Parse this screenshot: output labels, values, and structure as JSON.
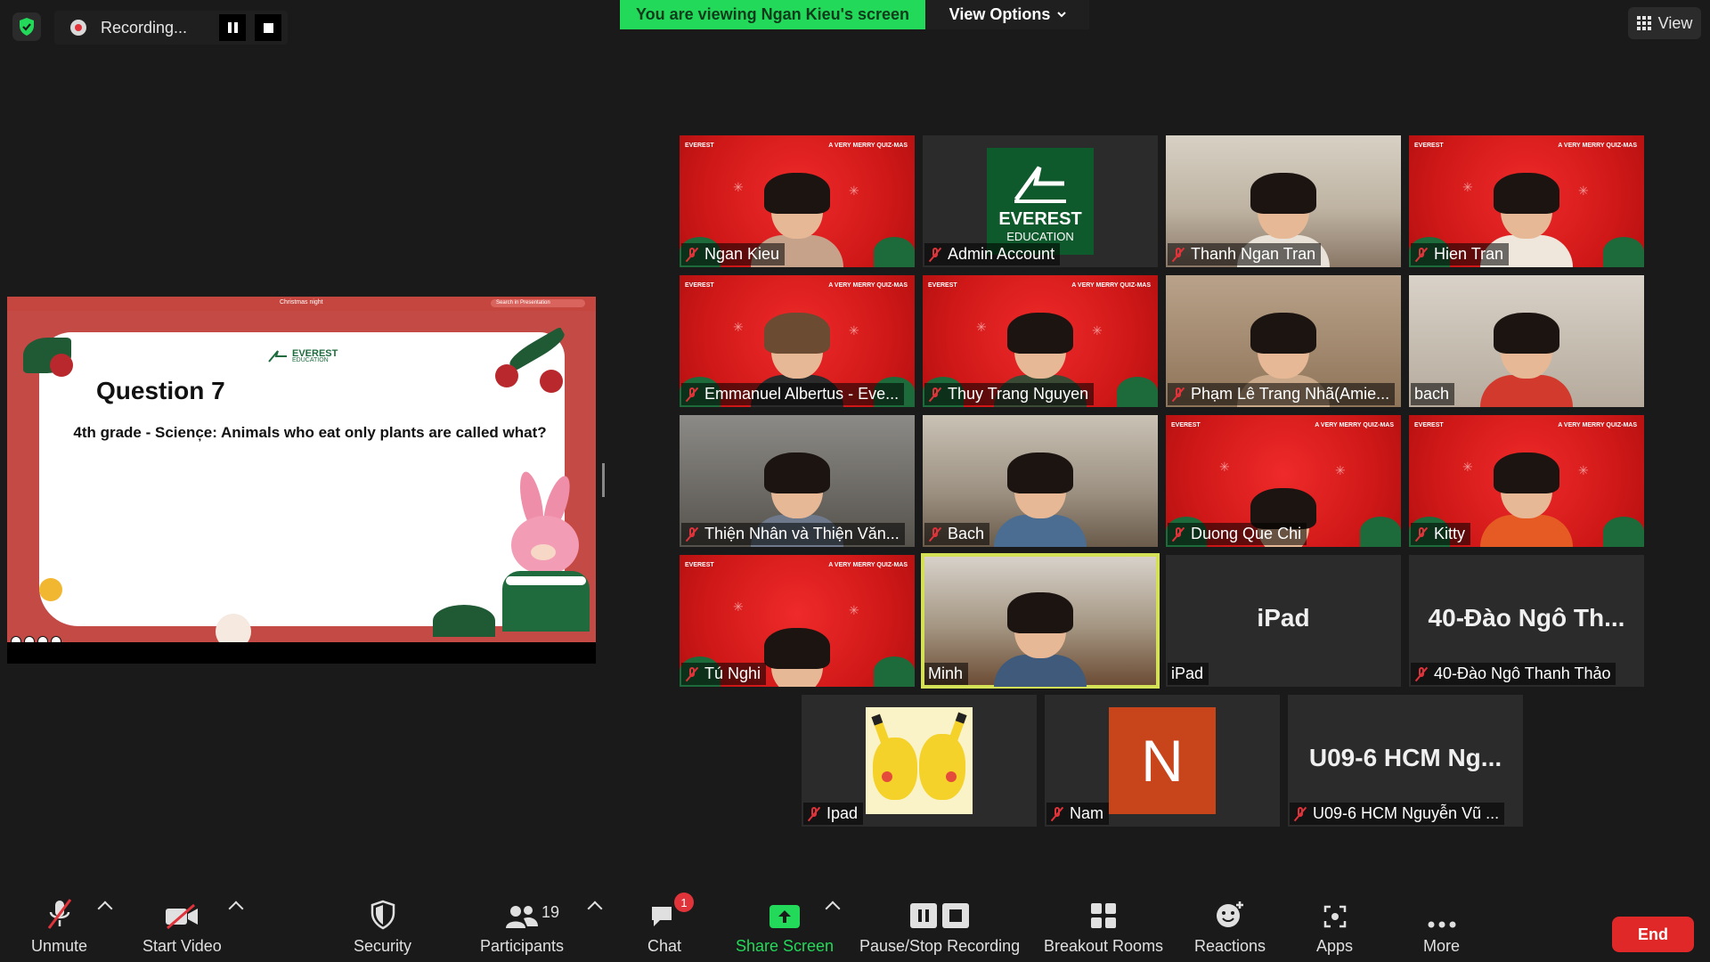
{
  "recording": {
    "label": "Recording..."
  },
  "banner": {
    "viewing": "You are viewing Ngan Kieu's screen",
    "view_options": "View Options"
  },
  "view_button": {
    "label": "View"
  },
  "share": {
    "window_title": "Christmas night",
    "search_placeholder": "Search in Presentation",
    "slide": {
      "logo_main": "EVEREST",
      "logo_sub": "EDUCATION",
      "question_title": "Question 7",
      "question_text": "4th grade - Scienc̦e: Animals who eat only plants are called what?"
    }
  },
  "xmas_overlay": {
    "logo": "EVEREST",
    "tag": "A VERY MERRY QUIZ-MAS"
  },
  "participants": [
    {
      "name": "Ngan Kieu"
    },
    {
      "name": "Admin Account",
      "logo_main": "EVEREST",
      "logo_sub": "EDUCATION"
    },
    {
      "name": "Thanh Ngan Tran"
    },
    {
      "name": "Hien Tran"
    },
    {
      "name": "Emmanuel Albertus - Eve..."
    },
    {
      "name": "Thuy Trang Nguyen"
    },
    {
      "name": "Phạm Lê Trang Nhã(Amie..."
    },
    {
      "name": "bach"
    },
    {
      "name": "Thiện Nhân và Thiện Văn..."
    },
    {
      "name": "Bach"
    },
    {
      "name": "Duong Que Chi"
    },
    {
      "name": "Kitty"
    },
    {
      "name": "Tú Nghi"
    },
    {
      "name": "Minh"
    },
    {
      "name": "iPad",
      "display": "iPad"
    },
    {
      "name": "40-Đào Ngô Thanh Thảo",
      "display": "40-Đào Ngô Th..."
    },
    {
      "name": "Ipad"
    },
    {
      "name": "Nam",
      "avatar_letter": "N"
    },
    {
      "name": "U09-6 HCM Nguyễn Vũ ...",
      "display": "U09-6 HCM Ng..."
    }
  ],
  "toolbar": {
    "unmute": "Unmute",
    "start_video": "Start Video",
    "security": "Security",
    "participants": "Participants",
    "participants_count": "19",
    "chat": "Chat",
    "chat_badge": "1",
    "share_screen": "Share Screen",
    "pause_stop": "Pause/Stop Recording",
    "breakout": "Breakout Rooms",
    "reactions": "Reactions",
    "apps": "Apps",
    "more": "More",
    "end": "End"
  },
  "colors": {
    "accent_green": "#23d959",
    "end_red": "#e02828",
    "active_speaker": "#d4e157"
  }
}
